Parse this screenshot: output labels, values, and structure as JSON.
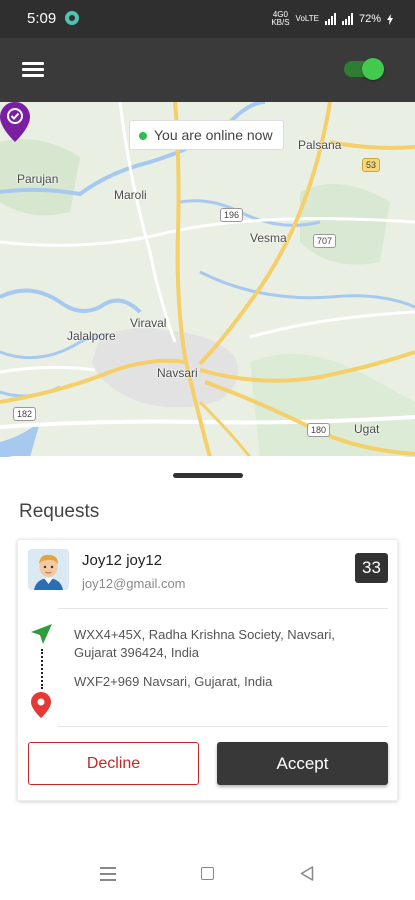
{
  "status_bar": {
    "time": "5:09",
    "network_top": "4G0",
    "network_bottom": "KB/S",
    "network_type": "VoLTE",
    "battery": "72%",
    "icons": [
      "app-notification-icon",
      "data-rate-icon",
      "volte-icon",
      "signal-icon",
      "battery-icon"
    ]
  },
  "app_bar": {
    "menu_icon": "hamburger-menu-icon",
    "online_toggle_on": true,
    "toggle_color": "#43c94d"
  },
  "map": {
    "online_chip_text": "You are online now",
    "online_dot_color": "#2ebd4e",
    "place_labels": [
      "Palsana",
      "Parujan",
      "Maroli",
      "Vesma",
      "Jalalpore",
      "Viraval",
      "Navsari",
      "Ugat"
    ],
    "road_badges": [
      "53",
      "196",
      "707",
      "182",
      "180"
    ],
    "pin_icon": "location-pin-icon",
    "pin_color": "#7b1fa2"
  },
  "requests": {
    "title": "Requests",
    "card": {
      "avatar_icon": "user-avatar-icon",
      "name": "Joy12 joy12",
      "email": "joy12@gmail.com",
      "count": "33",
      "pickup_icon": "navigation-arrow-icon",
      "pickup_address": "WXX4+45X, Radha Krishna Society, Navsari, Gujarat 396424, India",
      "drop_icon": "map-pin-icon",
      "drop_address": "WXF2+969 Navsari, Gujarat, India",
      "decline_label": "Decline",
      "accept_label": "Accept",
      "decline_color": "#c62828",
      "accept_color": "#383838"
    }
  },
  "nav_bar": {
    "icons": [
      "recent-apps-icon",
      "home-icon",
      "back-icon"
    ]
  }
}
